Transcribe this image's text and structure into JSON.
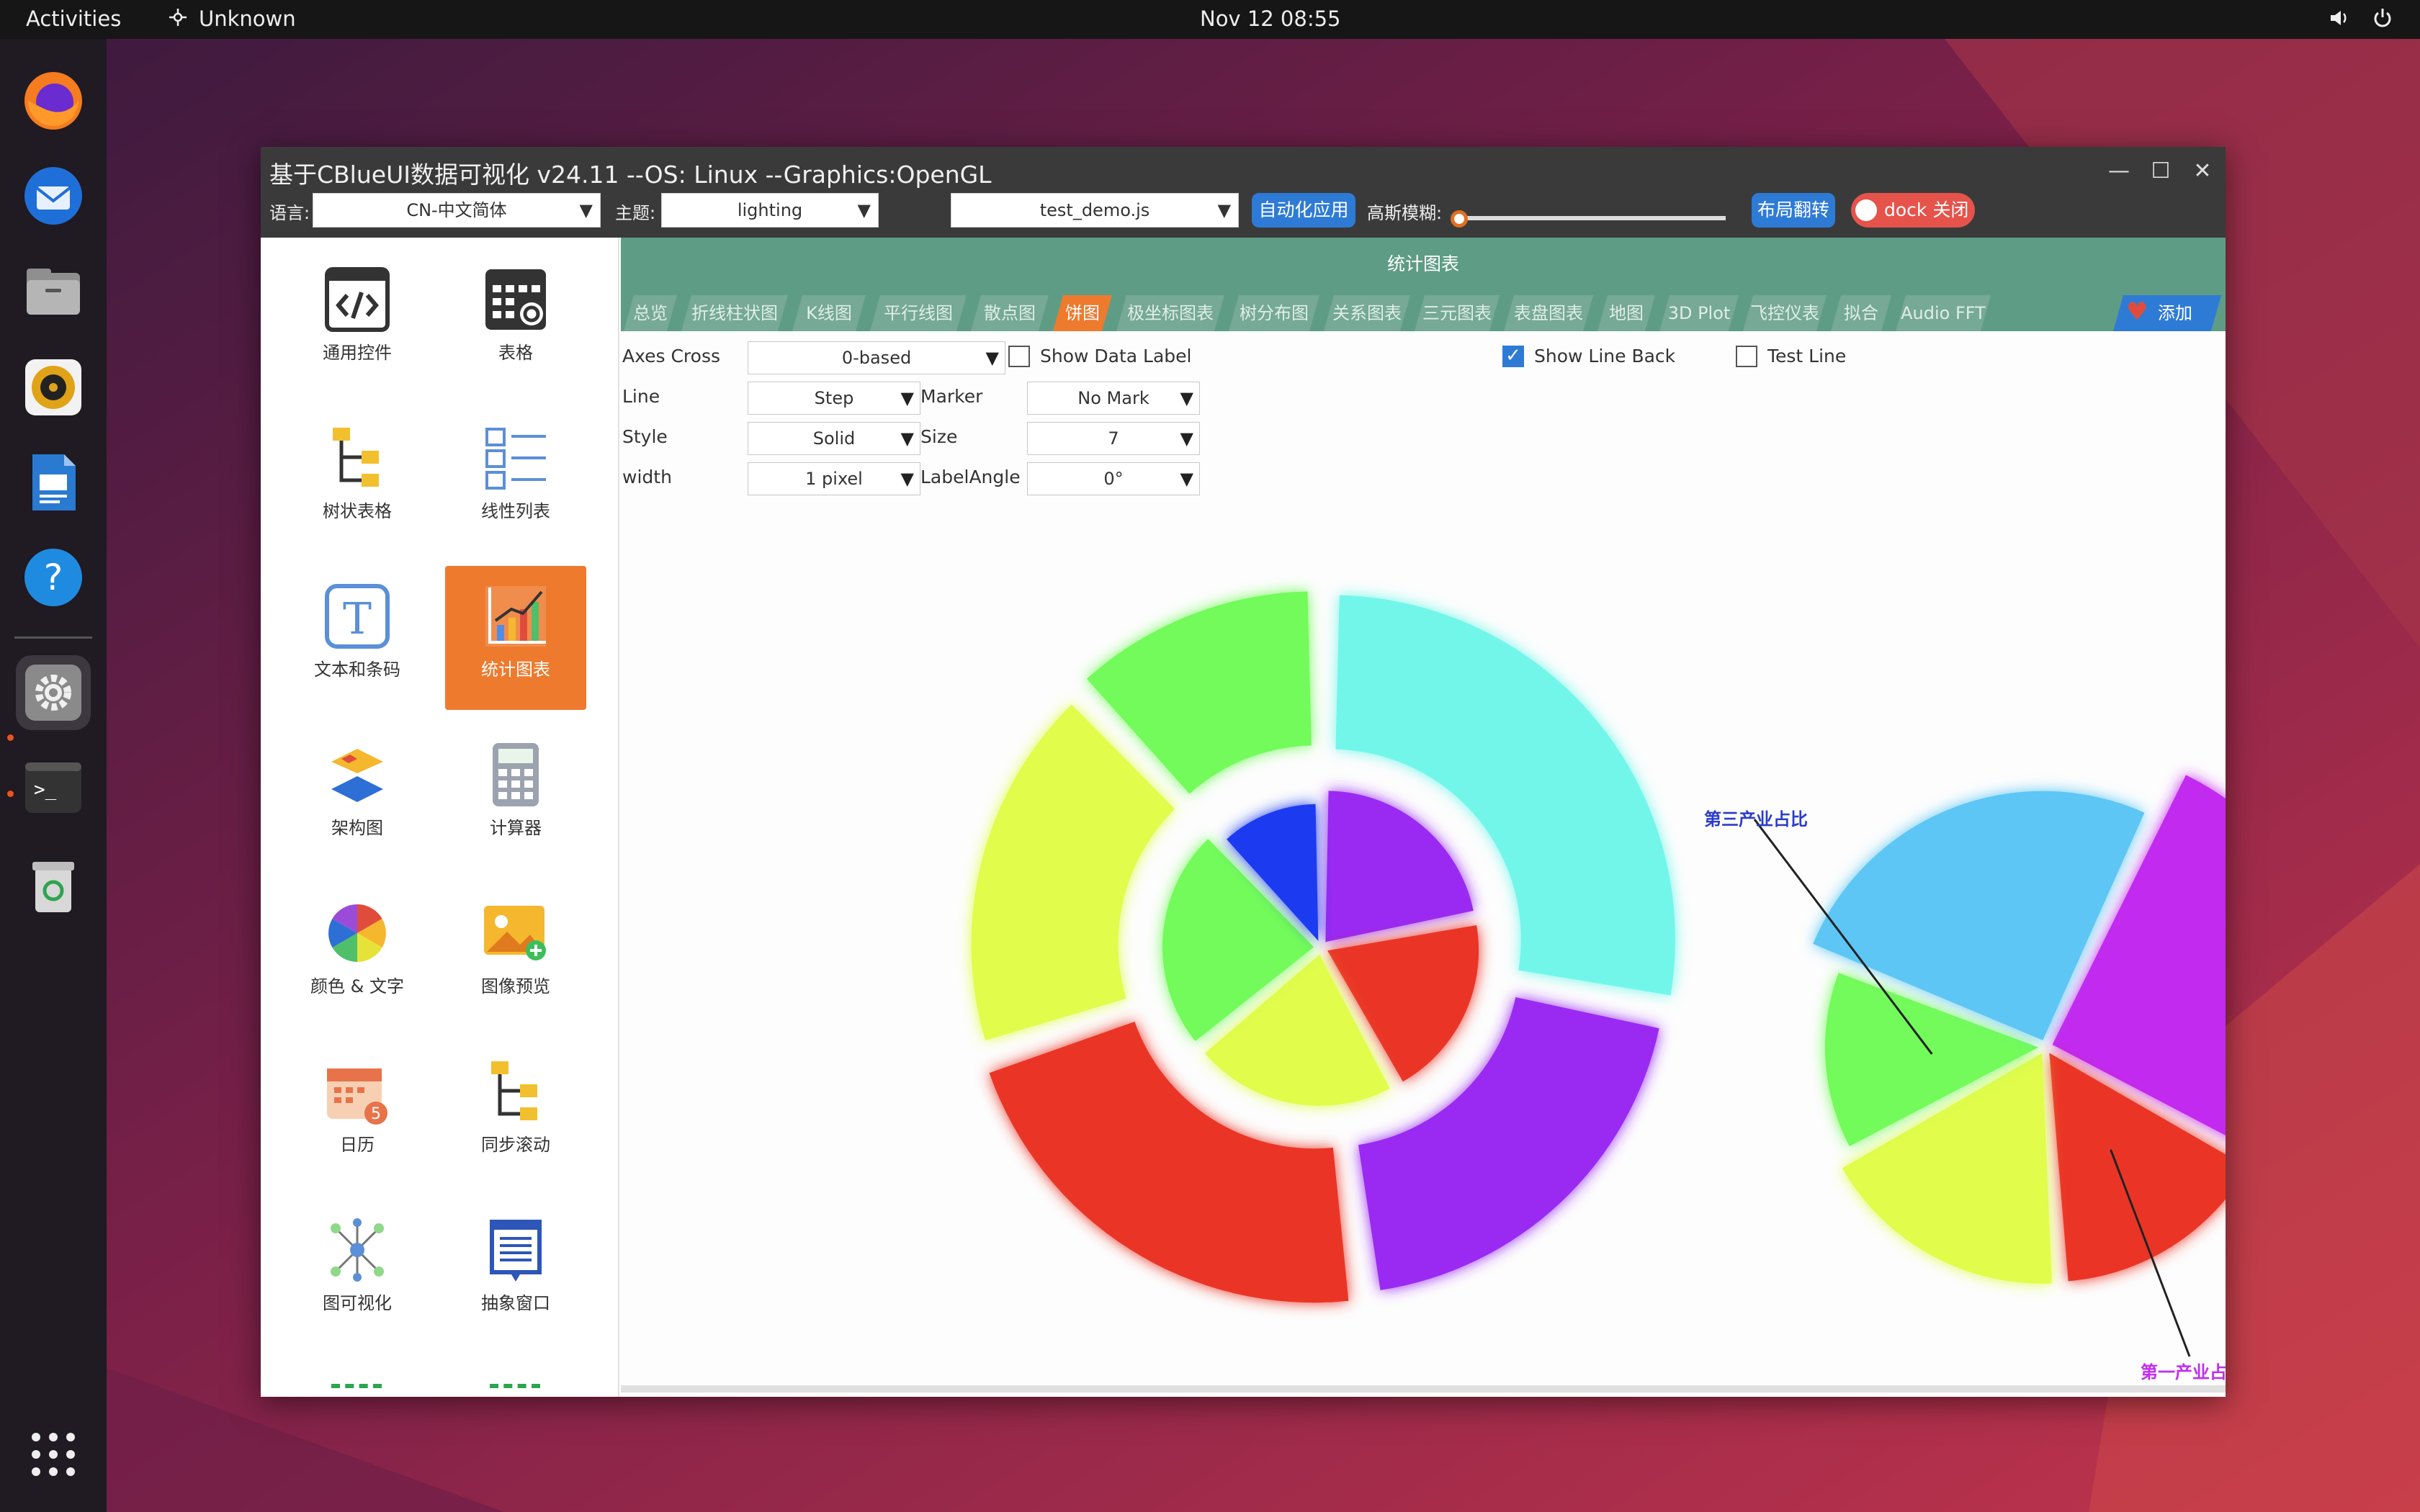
{
  "topbar": {
    "activities": "Activities",
    "app_name": "Unknown",
    "clock": "Nov 12  08:55"
  },
  "dock": {
    "apps": [
      {
        "icon": "firefox-icon"
      },
      {
        "icon": "thunderbird-icon"
      },
      {
        "icon": "files-icon"
      },
      {
        "icon": "rhythmbox-icon"
      },
      {
        "icon": "writer-icon"
      },
      {
        "icon": "help-icon"
      },
      {
        "icon": "settings-icon"
      },
      {
        "icon": "terminal-icon"
      },
      {
        "icon": "trash-icon"
      }
    ],
    "show_apps": "apps-grid-icon"
  },
  "window": {
    "title": "基于CBlueUI数据可视化  v24.11  --OS: Linux  --Graphics:OpenGL",
    "toolbar": {
      "language_label": "语言:",
      "language_value": "CN-中文简体",
      "theme_label": "主题:",
      "theme_value": "lighting",
      "script_value": "test_demo.js",
      "auto_apply": "自动化应用",
      "blur_label": "高斯模糊:",
      "blur_level": 0,
      "layout_flip": "布局翻转",
      "dock_toggle": "dock 关闭"
    },
    "sidebar": {
      "items": [
        {
          "label": "通用控件",
          "icon": "code-window-icon"
        },
        {
          "label": "表格",
          "icon": "table-gear-icon"
        },
        {
          "label": "树状表格",
          "icon": "tree-table-icon"
        },
        {
          "label": "线性列表",
          "icon": "linear-list-icon"
        },
        {
          "label": "文本和条码",
          "icon": "text-barcode-icon"
        },
        {
          "label": "统计图表",
          "icon": "statistics-chart-icon",
          "active": true
        },
        {
          "label": "架构图",
          "icon": "architecture-icon"
        },
        {
          "label": "计算器",
          "icon": "calculator-icon"
        },
        {
          "label": "颜色 & 文字",
          "icon": "color-wheel-icon"
        },
        {
          "label": "图像预览",
          "icon": "image-preview-icon"
        },
        {
          "label": "日历",
          "icon": "calendar-icon"
        },
        {
          "label": "同步滚动",
          "icon": "sync-scroll-icon"
        },
        {
          "label": "图可视化",
          "icon": "graph-visual-icon"
        },
        {
          "label": "抽象窗口",
          "icon": "abstract-window-icon"
        }
      ]
    },
    "section_title": "统计图表",
    "tabs": [
      "总览",
      "折线柱状图",
      "K线图",
      "平行线图",
      "散点图",
      "饼图",
      "极坐标图表",
      "树分布图",
      "关系图表",
      "三元图表",
      "表盘图表",
      "地图",
      "3D Plot",
      "飞控仪表",
      "拟合",
      "Audio FFT"
    ],
    "active_tab": "饼图",
    "add_tab": "添加",
    "controls": {
      "axes_cross_label": "Axes Cross",
      "axes_cross_value": "0-based",
      "show_data_label": "Show Data Label",
      "show_data_label_checked": false,
      "show_line_back": "Show Line Back",
      "show_line_back_checked": true,
      "test_line": "Test Line",
      "test_line_checked": false,
      "line_label": "Line",
      "line_value": "Step",
      "marker_label": "Marker",
      "marker_value": "No Mark",
      "style_label": "Style",
      "style_value": "Solid",
      "size_label": "Size",
      "size_value": "7",
      "width_label": "width",
      "width_value": "1 pixel",
      "label_angle_label": "LabelAngle",
      "label_angle_value": "0°"
    }
  },
  "colors": {
    "cyan": "#72f6ea",
    "purple": "#9a2cf2",
    "red": "#ea3427",
    "yellow": "#e1fc4c",
    "green": "#72fb5a",
    "blue": "#1a3af0",
    "sky": "#5dc6f5",
    "magenta": "#c22cf0"
  },
  "chart_data": [
    {
      "type": "pie",
      "variant": "nested-donut",
      "rings": [
        {
          "name": "outer",
          "slices": [
            {
              "color": "#72f6ea",
              "value": 28
            },
            {
              "color": "#9a2cf2",
              "value": 20
            },
            {
              "color": "#ea3427",
              "value": 22
            },
            {
              "color": "#e1fc4c",
              "value": 18
            },
            {
              "color": "#72fb5a",
              "value": 12
            }
          ]
        },
        {
          "name": "inner",
          "slices": [
            {
              "color": "#9a2cf2",
              "value": 22
            },
            {
              "color": "#ea3427",
              "value": 20
            },
            {
              "color": "#e1fc4c",
              "value": 22
            },
            {
              "color": "#72fb5a",
              "value": 24
            },
            {
              "color": "#1a3af0",
              "value": 12
            }
          ]
        }
      ]
    },
    {
      "type": "pie",
      "variant": "rose",
      "annotations": [
        "第三产业占比",
        "第一产业占比"
      ],
      "slices": [
        {
          "color": "#c22cf0",
          "value": 26
        },
        {
          "color": "#ea3427",
          "value": 16
        },
        {
          "color": "#e1fc4c",
          "value": 18
        },
        {
          "color": "#72fb5a",
          "value": 14
        },
        {
          "color": "#5dc6f5",
          "value": 26
        }
      ]
    }
  ]
}
